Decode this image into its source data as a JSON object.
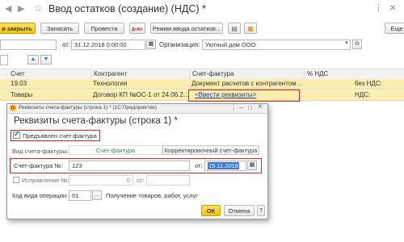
{
  "window": {
    "title": "Ввод остатков (создание) (НДС) *",
    "close_glyph": "×",
    "bookmark_glyph": "☆"
  },
  "toolbar": {
    "post_close": "и закрыть",
    "save": "Записать",
    "post": "Провести",
    "input_mode": "Режим ввода остатков...",
    "more": "Еще",
    "help": "?"
  },
  "header": {
    "date_label": "от:",
    "date_value": "31.12.2018  0:00:00",
    "org_label": "Организация:",
    "org_value": "Уютный дом ООО"
  },
  "table": {
    "columns": [
      "Счет",
      "Контрагент",
      "Счет-фактура",
      "% НДС"
    ],
    "rows": [
      {
        "account": "19.03",
        "counterparty": "Технология",
        "invoice": "Документ расчетов с контрагентом ...",
        "vat": "",
        "tail": "без НДС:"
      },
      {
        "account": "Товары",
        "counterparty": "Договор КП №ОС-1 от 24.06.2...",
        "invoice": "<Ввести реквизиты>",
        "vat": "",
        "tail": "НДС:"
      }
    ]
  },
  "dialog": {
    "caption": "Реквизиты счета-фактуры (строка 1) * (1С:Предприятие)",
    "heading": "Реквизиты счета-фактуры (строка 1) *",
    "presented_label": "Предъявлен счет-фактура",
    "presented_checked": true,
    "kind_label": "Вид счета-фактуры:",
    "kind_tabs": [
      "Счет-фактура",
      "Корректировочный счет-фактура"
    ],
    "number_label": "Счет-фактура №:",
    "number_value": "123",
    "date_label": "от:",
    "date_value": "15.11.2018",
    "correction_label": "Исправление №:",
    "correction_value": "0",
    "correction_date_label": "от:",
    "correction_date_value": ". .",
    "op_code_label": "Код вида операции:",
    "op_code_value": "01",
    "op_code_desc": "Получение товаров, работ, услуг",
    "ok": "ОК",
    "cancel": "Отмена",
    "help": "?",
    "menu_glyph": "⋮",
    "minimize_glyph": "–",
    "maximize_glyph": "□",
    "close_glyph": "×"
  },
  "colors": {
    "accent_yellow": "#f5c400",
    "row_highlight": "#fbeeb0",
    "tab_green": "#2e9b3a",
    "red_box": "#e52020",
    "selection": "#3b78d8"
  }
}
